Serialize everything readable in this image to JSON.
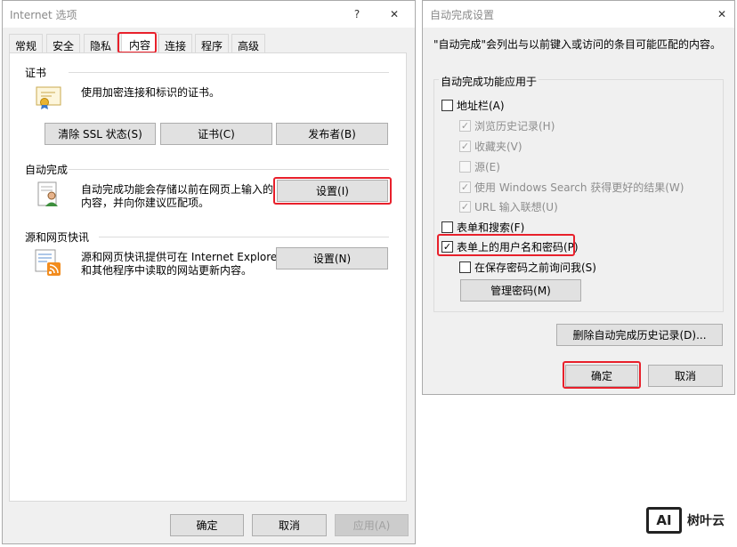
{
  "left_window": {
    "title": "Internet 选项",
    "help": "?",
    "close": "✕",
    "tabs": [
      {
        "label": "常规"
      },
      {
        "label": "安全"
      },
      {
        "label": "隐私"
      },
      {
        "label": "内容"
      },
      {
        "label": "连接"
      },
      {
        "label": "程序"
      },
      {
        "label": "高级"
      }
    ],
    "active_tab": "内容",
    "certificates": {
      "title": "证书",
      "description": "使用加密连接和标识的证书。",
      "buttons": {
        "clear_ssl": "清除 SSL 状态(S)",
        "certificates": "证书(C)",
        "publishers": "发布者(B)"
      }
    },
    "autocomplete": {
      "title": "自动完成",
      "description_line1": "自动完成功能会存储以前在网页上输入的",
      "description_line2": "内容，并向你建议匹配项。",
      "settings_button": "设置(I)"
    },
    "feeds": {
      "title": "源和网页快讯",
      "description_line1": "源和网页快讯提供可在 Internet Explorer",
      "description_line2": "和其他程序中读取的网站更新内容。",
      "settings_button": "设置(N)"
    },
    "footer": {
      "ok": "确定",
      "cancel": "取消",
      "apply": "应用(A)"
    }
  },
  "right_window": {
    "title": "自动完成设置",
    "close": "✕",
    "intro": "\"自动完成\"会列出与以前键入或访问的条目可能匹配的内容。",
    "group_title": "自动完成功能应用于",
    "options": {
      "address_bar": {
        "label": "地址栏(A)",
        "checked": false
      },
      "browsing_history": {
        "label": "浏览历史记录(H)",
        "checked": true
      },
      "favorites": {
        "label": "收藏夹(V)",
        "checked": true
      },
      "feeds": {
        "label": "源(E)",
        "checked": false
      },
      "windows_search": {
        "label": "使用 Windows Search 获得更好的结果(W)",
        "checked": true
      },
      "url_suggestions": {
        "label": "URL 输入联想(U)",
        "checked": true
      },
      "forms_search": {
        "label": "表单和搜索(F)",
        "checked": false
      },
      "usernames_passwords": {
        "label": "表单上的用户名和密码(P)",
        "checked": true
      },
      "ask_before_saving": {
        "label": "在保存密码之前询问我(S)",
        "checked": false
      }
    },
    "manage_passwords": "管理密码(M)",
    "delete_history": "删除自动完成历史记录(D)...",
    "ok": "确定",
    "cancel": "取消"
  },
  "watermark": {
    "logo": "AI",
    "text": "树叶云"
  },
  "colors": {
    "highlight": "#e8202b",
    "window_bg": "#f0f0f0",
    "button_bg": "#e1e1e1"
  }
}
